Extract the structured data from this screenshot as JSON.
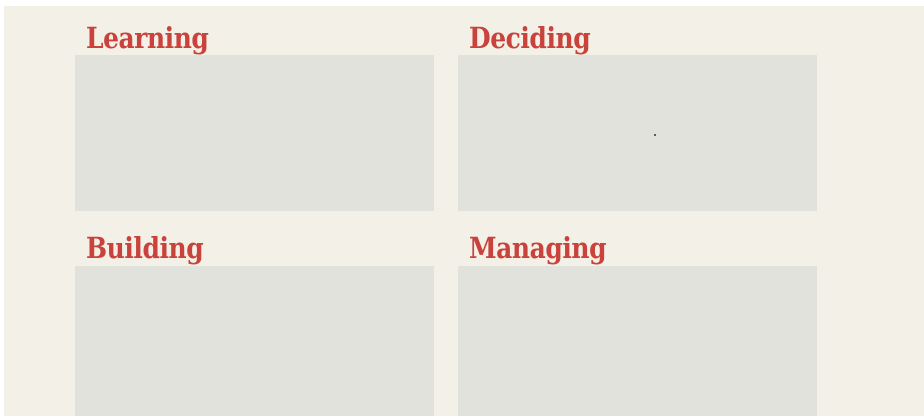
{
  "sections": [
    {
      "title": "Learning"
    },
    {
      "title": "Deciding"
    },
    {
      "title": "Building"
    },
    {
      "title": "Managing"
    }
  ],
  "colors": {
    "background": "#f2f0e7",
    "title": "#c9423b",
    "panel": "#e2e2dd"
  }
}
